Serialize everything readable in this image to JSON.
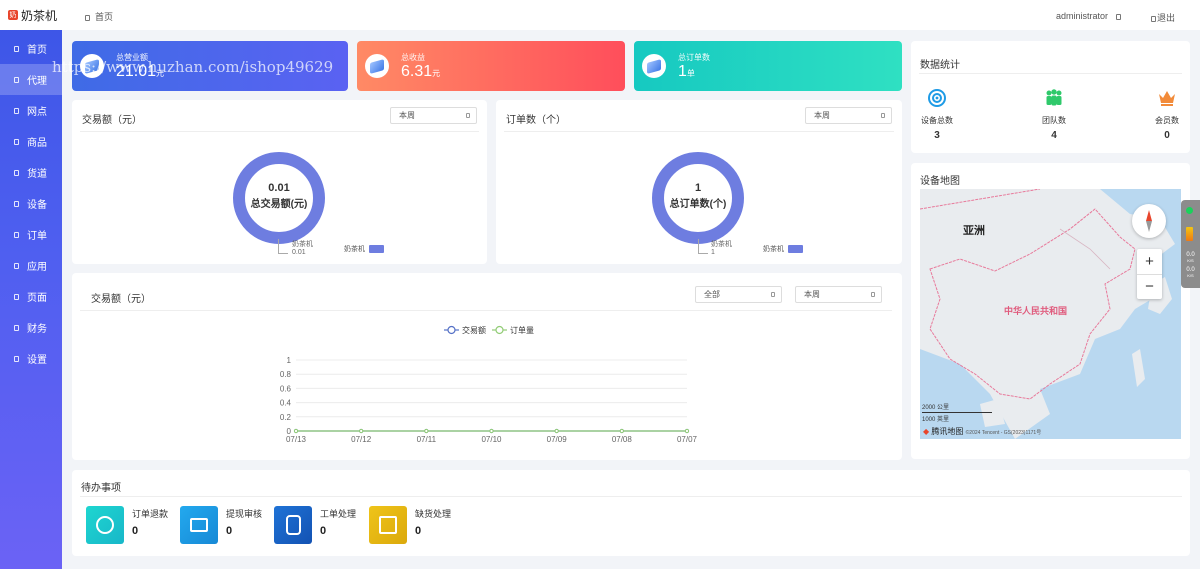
{
  "app": {
    "name": "奶茶机",
    "logo_char": "奶"
  },
  "colors": {
    "sidebar": "#4f5ff0",
    "accent": "#6e7de0",
    "line": "#8fd17a",
    "revenue_card": "#3b55e6",
    "income_card": "#ff5a5f",
    "orders_card": "#21d4c6"
  },
  "sidebar": {
    "items": [
      {
        "label": "首页"
      },
      {
        "label": "代理",
        "active": true
      },
      {
        "label": "网点"
      },
      {
        "label": "商品"
      },
      {
        "label": "货道"
      },
      {
        "label": "设备"
      },
      {
        "label": "订单"
      },
      {
        "label": "应用"
      },
      {
        "label": "页面"
      },
      {
        "label": "财务"
      },
      {
        "label": "设置"
      }
    ]
  },
  "topbar": {
    "breadcrumb": "首页",
    "user": "administrator",
    "logout": "退出"
  },
  "watermark": "https://www.huzhan.com/ishop49629",
  "stats": [
    {
      "label": "总营业额",
      "value": "21.01",
      "unit": "元",
      "icon": "cube-icon"
    },
    {
      "label": "总收益",
      "value": "6.31",
      "unit": "元",
      "icon": "cube-icon"
    },
    {
      "label": "总订单数",
      "value": "1",
      "unit": "单",
      "icon": "cube-icon"
    }
  ],
  "donut_amount": {
    "title": "交易额（元）",
    "select": "本周",
    "center_value": "0.01",
    "center_label": "总交易额(元)",
    "legend_label": "奶茶机",
    "callout_name": "奶茶机",
    "callout_value": "0.01"
  },
  "donut_orders": {
    "title": "订单数（个）",
    "select": "本周",
    "center_value": "1",
    "center_label": "总订单数(个)",
    "legend_label": "奶茶机",
    "callout_name": "奶茶机",
    "callout_value": "1"
  },
  "trend": {
    "title": "交易额（元）",
    "select_scope": "全部",
    "select_period": "本周"
  },
  "chart_data": {
    "type": "line",
    "x": [
      "07/13",
      "07/12",
      "07/11",
      "07/10",
      "07/09",
      "07/08",
      "07/07"
    ],
    "series": [
      {
        "name": "交易额",
        "color": "#5470c6",
        "values": [
          0,
          0,
          0,
          0,
          0,
          0,
          0
        ]
      },
      {
        "name": "订单量",
        "color": "#91cc75",
        "values": [
          0,
          0,
          0,
          0,
          0,
          0,
          0
        ]
      }
    ],
    "yticks": [
      "0",
      "0.2",
      "0.4",
      "0.6",
      "0.8",
      "1"
    ],
    "ylim": [
      0,
      1
    ],
    "legend": "top-center",
    "grid": true
  },
  "data_stats": {
    "title": "数据统计",
    "items": [
      {
        "label": "设备总数",
        "value": "3",
        "icon": "target-icon"
      },
      {
        "label": "团队数",
        "value": "4",
        "icon": "team-icon"
      },
      {
        "label": "会员数",
        "value": "0",
        "icon": "crown-icon"
      }
    ]
  },
  "device_map": {
    "title": "设备地图",
    "region_asia": "亚洲",
    "country": "中华人民共和国",
    "scale_metric": "2000 公里",
    "scale_imperial": "1000 英里",
    "provider": "腾讯地图",
    "copyright": "©2024 Tencent - GS(2023)1171号",
    "zoom_in": "+",
    "zoom_out": "−",
    "side_val1": "0.0",
    "side_unit1": "K/S",
    "side_val2": "0.0",
    "side_unit2": "K/S"
  },
  "todo": {
    "title": "待办事项",
    "items": [
      {
        "label": "订单退款",
        "value": "0",
        "color": "#1ec8c8",
        "icon": "yen-refund-icon"
      },
      {
        "label": "提现审核",
        "value": "0",
        "color": "#1e9be6",
        "icon": "card-icon"
      },
      {
        "label": "工单处理",
        "value": "0",
        "color": "#1866c8",
        "icon": "clipboard-check-icon"
      },
      {
        "label": "缺货处理",
        "value": "0",
        "color": "#e6bb13",
        "icon": "box-plus-icon"
      }
    ]
  }
}
